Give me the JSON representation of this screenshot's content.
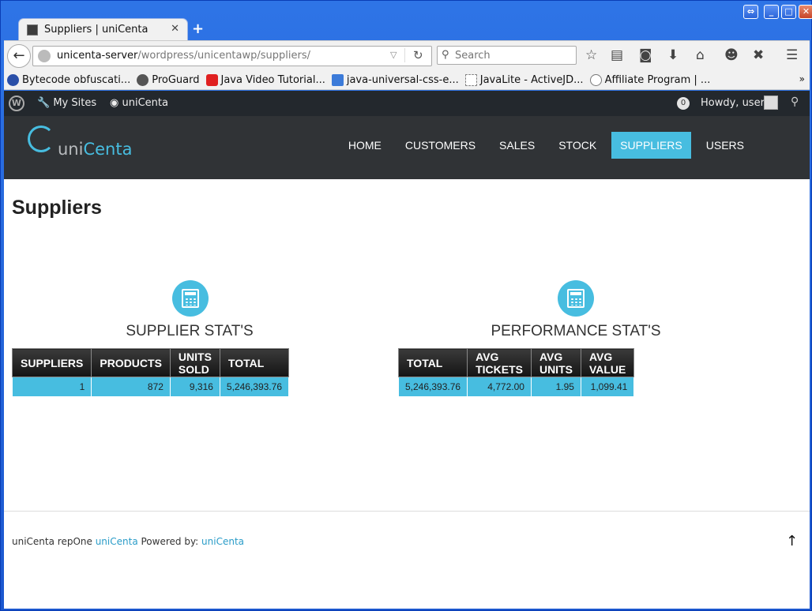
{
  "browser": {
    "tab_title": "Suppliers | uniCenta",
    "new_tab": "+",
    "url_host": "unicenta-server",
    "url_path": "/wordpress/unicentawp/suppliers/",
    "search_placeholder": "Search",
    "bookmarks": [
      {
        "label": "Bytecode obfuscati...",
        "color": "#2A4FA8"
      },
      {
        "label": "ProGuard",
        "color": "#555555"
      },
      {
        "label": "Java Video Tutorial...",
        "color": "#E02020"
      },
      {
        "label": "java-universal-css-e...",
        "color": "#3C7BD9"
      },
      {
        "label": "JavaLite - ActiveJD...",
        "color": "#FFFFFF"
      },
      {
        "label": "Affiliate Program | ...",
        "color": "#777777"
      }
    ],
    "bookmarks_more": "»"
  },
  "adminbar": {
    "my_sites": "My Sites",
    "site_name": "uniCenta",
    "comments_count": "0",
    "howdy": "Howdy, user"
  },
  "site": {
    "logo_prefix": "uni",
    "logo_suffix": "Centa",
    "menu": [
      "HOME",
      "CUSTOMERS",
      "SALES",
      "STOCK",
      "SUPPLIERS",
      "USERS"
    ],
    "active_menu": "SUPPLIERS",
    "accent_color": "#47BDE0"
  },
  "page": {
    "title": "Suppliers",
    "supplier_stats": {
      "heading": "SUPPLIER STAT'S",
      "columns": [
        "SUPPLIERS",
        "PRODUCTS",
        "UNITS SOLD",
        "TOTAL"
      ],
      "row": [
        "1",
        "872",
        "9,316",
        "5,246,393.76"
      ]
    },
    "performance_stats": {
      "heading": "PERFORMANCE STAT'S",
      "columns": [
        "TOTAL",
        "AVG TICKETS",
        "AVG UNITS",
        "AVG VALUE"
      ],
      "row": [
        "5,246,393.76",
        "4,772.00",
        "1.95",
        "1,099.41"
      ]
    }
  },
  "footer": {
    "prefix": "uniCenta repOne",
    "link1": " uniCenta",
    "powered_by": " Powered by: ",
    "link2": "uniCenta",
    "up_arrow": "↑"
  }
}
